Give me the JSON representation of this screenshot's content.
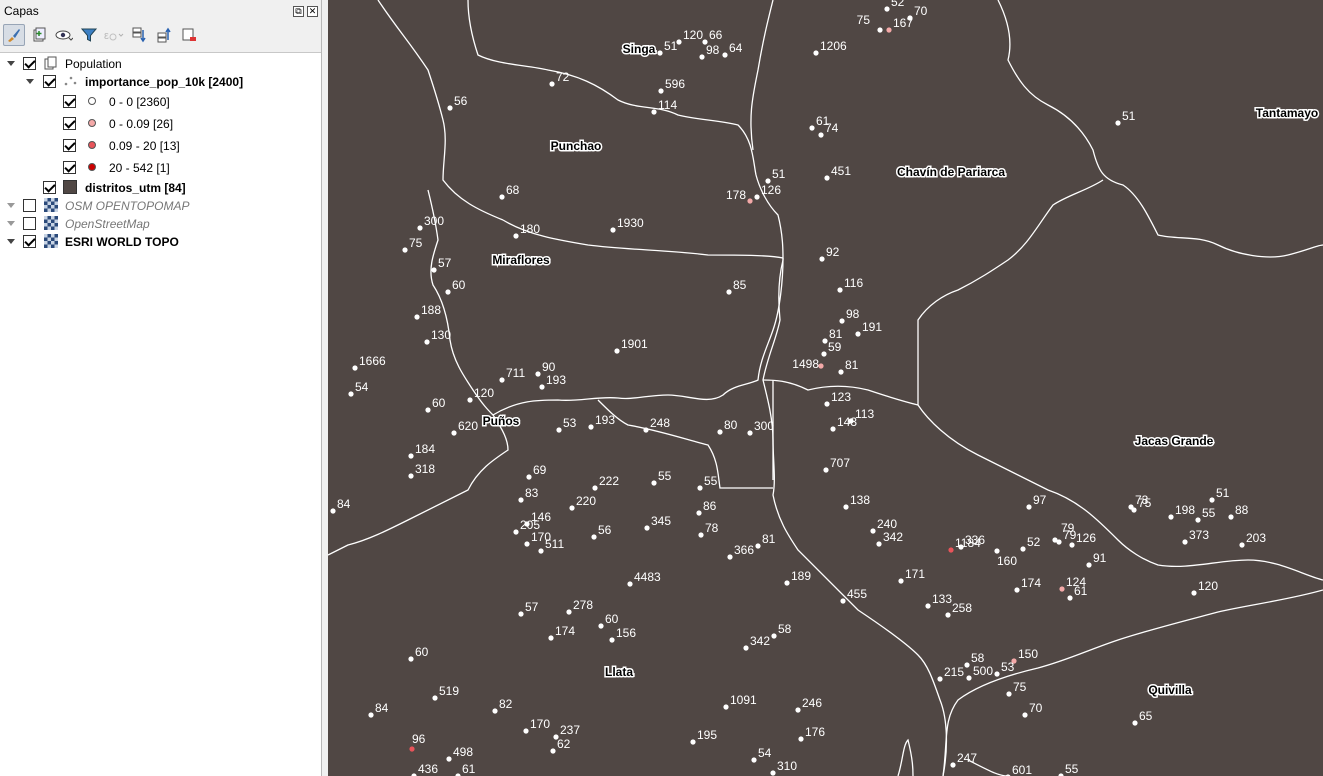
{
  "panel": {
    "title": "Capas"
  },
  "layers": [
    {
      "label": "Population",
      "checked": true,
      "bold": false,
      "italic": false,
      "symbol": "group"
    },
    {
      "label": "importance_pop_10k [2400]",
      "checked": true,
      "bold": true,
      "italic": false,
      "symbol": "points"
    },
    {
      "label": "0 - 0 [2360]",
      "checked": true,
      "color": "#ffffff"
    },
    {
      "label": "0 - 0.09 [26]",
      "checked": true,
      "color": "#f4a9a8"
    },
    {
      "label": "0.09 - 20 [13]",
      "checked": true,
      "color": "#e8545a"
    },
    {
      "label": "20 - 542 [1]",
      "checked": true,
      "color": "#cc0000"
    },
    {
      "label": "distritos_utm [84]",
      "checked": true,
      "bold": true,
      "symbol": "polygon"
    },
    {
      "label": "OSM OPENTOPOMAP",
      "checked": false,
      "italic": true,
      "symbol": "tile"
    },
    {
      "label": "OpenStreetMap",
      "checked": false,
      "italic": true,
      "symbol": "tile"
    },
    {
      "label": "ESRI WORLD TOPO",
      "checked": true,
      "bold": true,
      "symbol": "tile"
    }
  ],
  "toolbar_icons": [
    "style-manager-icon",
    "add-group-icon",
    "eye-icon",
    "filter-icon",
    "filter-expression-icon",
    "expand-all-icon",
    "collapse-all-icon",
    "remove-layer-icon"
  ],
  "map": {
    "background": "#504744",
    "district_labels": [
      "Singa",
      "Punchao",
      "Chavín de Pariarca",
      "Tantamayo",
      "Miraflores",
      "Puños",
      "Jacas Grande",
      "Llata",
      "Quivilla"
    ],
    "points": [
      {
        "v": "52"
      },
      {
        "v": "70"
      },
      {
        "v": "75"
      },
      {
        "v": "167"
      },
      {
        "v": "120"
      },
      {
        "v": "66"
      },
      {
        "v": "51"
      },
      {
        "v": "98"
      },
      {
        "v": "64"
      },
      {
        "v": "1206"
      },
      {
        "v": "72"
      },
      {
        "v": "596"
      },
      {
        "v": "114"
      },
      {
        "v": "56"
      },
      {
        "v": "61"
      },
      {
        "v": "74"
      },
      {
        "v": "51"
      },
      {
        "v": "51"
      },
      {
        "v": "451"
      },
      {
        "v": "178"
      },
      {
        "v": "126"
      },
      {
        "v": "68"
      },
      {
        "v": "300"
      },
      {
        "v": "1930"
      },
      {
        "v": "75"
      },
      {
        "v": "180"
      },
      {
        "v": "92"
      },
      {
        "v": "57"
      },
      {
        "v": "60"
      },
      {
        "v": "85"
      },
      {
        "v": "116"
      },
      {
        "v": "188"
      },
      {
        "v": "98"
      },
      {
        "v": "191"
      },
      {
        "v": "130"
      },
      {
        "v": "81"
      },
      {
        "v": "59"
      },
      {
        "v": "1901"
      },
      {
        "v": "1666"
      },
      {
        "v": "1498"
      },
      {
        "v": "81"
      },
      {
        "v": "711"
      },
      {
        "v": "90"
      },
      {
        "v": "54"
      },
      {
        "v": "193"
      },
      {
        "v": "120"
      },
      {
        "v": "123"
      },
      {
        "v": "60"
      },
      {
        "v": "113"
      },
      {
        "v": "143"
      },
      {
        "v": "620"
      },
      {
        "v": "53"
      },
      {
        "v": "193"
      },
      {
        "v": "248"
      },
      {
        "v": "80"
      },
      {
        "v": "300"
      },
      {
        "v": "184"
      },
      {
        "v": "707"
      },
      {
        "v": "318"
      },
      {
        "v": "69"
      },
      {
        "v": "222"
      },
      {
        "v": "55"
      },
      {
        "v": "55"
      },
      {
        "v": "75"
      },
      {
        "v": "84"
      },
      {
        "v": "83"
      },
      {
        "v": "220"
      },
      {
        "v": "86"
      },
      {
        "v": "138"
      },
      {
        "v": "97"
      },
      {
        "v": "73"
      },
      {
        "v": "51"
      },
      {
        "v": "198"
      },
      {
        "v": "55"
      },
      {
        "v": "88"
      },
      {
        "v": "146"
      },
      {
        "v": "205"
      },
      {
        "v": "56"
      },
      {
        "v": "345"
      },
      {
        "v": "78"
      },
      {
        "v": "240"
      },
      {
        "v": "170"
      },
      {
        "v": "342"
      },
      {
        "v": "1184"
      },
      {
        "v": "79"
      },
      {
        "v": "126"
      },
      {
        "v": "373"
      },
      {
        "v": "203"
      },
      {
        "v": "511"
      },
      {
        "v": "366"
      },
      {
        "v": "81"
      },
      {
        "v": "336"
      },
      {
        "v": "160"
      },
      {
        "v": "52"
      },
      {
        "v": "79"
      },
      {
        "v": "91"
      },
      {
        "v": "4483"
      },
      {
        "v": "189"
      },
      {
        "v": "171"
      },
      {
        "v": "174"
      },
      {
        "v": "124"
      },
      {
        "v": "120"
      },
      {
        "v": "61"
      },
      {
        "v": "455"
      },
      {
        "v": "133"
      },
      {
        "v": "258"
      },
      {
        "v": "57"
      },
      {
        "v": "278"
      },
      {
        "v": "60"
      },
      {
        "v": "156"
      },
      {
        "v": "174"
      },
      {
        "v": "342"
      },
      {
        "v": "58"
      },
      {
        "v": "60"
      },
      {
        "v": "58"
      },
      {
        "v": "150"
      },
      {
        "v": "53"
      },
      {
        "v": "215"
      },
      {
        "v": "500"
      },
      {
        "v": "519"
      },
      {
        "v": "1091"
      },
      {
        "v": "246"
      },
      {
        "v": "75"
      },
      {
        "v": "84"
      },
      {
        "v": "82"
      },
      {
        "v": "70"
      },
      {
        "v": "65"
      },
      {
        "v": "170"
      },
      {
        "v": "237"
      },
      {
        "v": "195"
      },
      {
        "v": "176"
      },
      {
        "v": "96"
      },
      {
        "v": "498"
      },
      {
        "v": "62"
      },
      {
        "v": "54"
      },
      {
        "v": "247"
      },
      {
        "v": "436"
      },
      {
        "v": "61"
      },
      {
        "v": "310"
      },
      {
        "v": "601"
      },
      {
        "v": "55"
      }
    ]
  }
}
